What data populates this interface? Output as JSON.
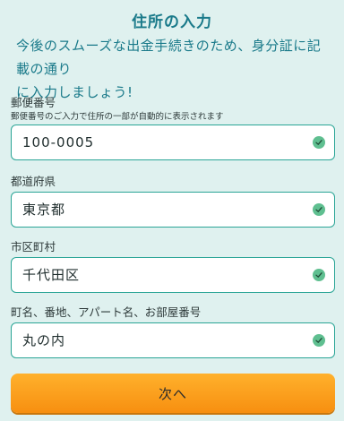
{
  "page": {
    "title": "住所の入力",
    "intro_line1": "今後のスムーズな出金手続きのため、身分証に記載の通り",
    "intro_line2": "に入力しましょう!"
  },
  "fields": [
    {
      "label": "郵便番号",
      "hint": "郵便番号のご入力で住所の一部が自動的に表示されます",
      "value": "100-0005",
      "valid_icon": "check-circle-icon"
    },
    {
      "label": "都道府県",
      "value": "東京都",
      "valid_icon": "check-circle-icon"
    },
    {
      "label": "市区町村",
      "value": "千代田区",
      "valid_icon": "check-circle-icon"
    },
    {
      "label": "町名、番地、アパート名、お部屋番号",
      "value": "丸の内",
      "valid_icon": "check-circle-icon"
    }
  ],
  "actions": {
    "next_label": "次へ"
  },
  "colors": {
    "background": "#dff1ef",
    "accent": "#1a7a8a",
    "field_border": "#2aa596",
    "check": "#5fbf90",
    "button_top": "#ffb12c",
    "button_bottom": "#f78f10"
  }
}
